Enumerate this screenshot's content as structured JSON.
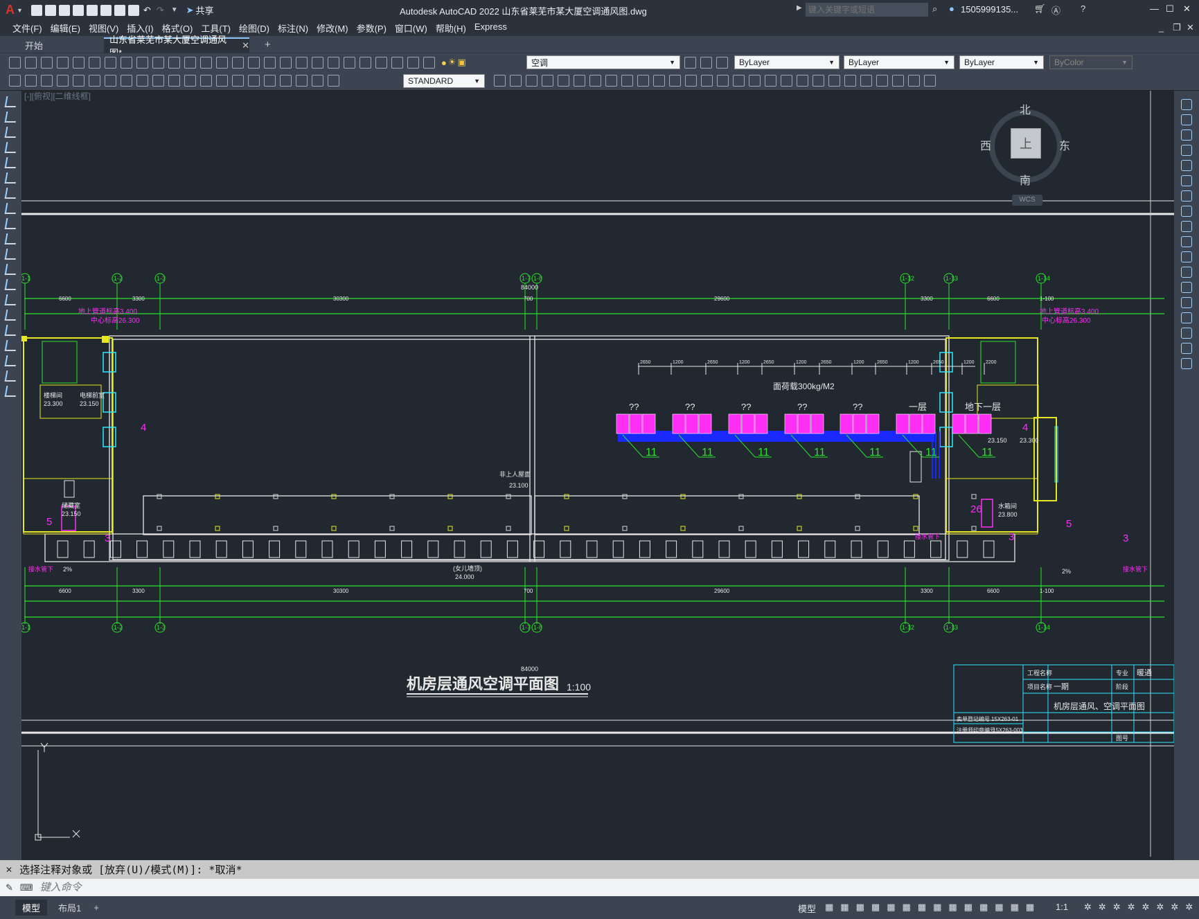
{
  "window": {
    "title": "Autodesk AutoCAD 2022    山东省莱芜市某大厦空调通风图.dwg",
    "share": "共享",
    "search_placeholder": "键入关键字或短语",
    "user": "1505999135...",
    "controls": {
      "min": "—",
      "max": "☐",
      "close": "✕"
    }
  },
  "menubar": {
    "items": [
      "文件(F)",
      "编辑(E)",
      "视图(V)",
      "插入(I)",
      "格式(O)",
      "工具(T)",
      "绘图(D)",
      "标注(N)",
      "修改(M)",
      "参数(P)",
      "窗口(W)",
      "帮助(H)",
      "Express"
    ]
  },
  "tabs": {
    "items": [
      {
        "label": "开始",
        "active": false
      },
      {
        "label": "山东省莱芜市某大厦空调通风图*",
        "active": true
      }
    ],
    "add": "+"
  },
  "toolbar1": {
    "layer": "空调",
    "color": "ByLayer",
    "linetype": "ByLayer",
    "lineweight": "ByLayer",
    "plotstyle": "ByColor"
  },
  "toolbar2": {
    "textstyle": "STANDARD"
  },
  "viewport": {
    "label": "[-][俯视][二维线框]",
    "viewcube": {
      "top": "上",
      "north": "北",
      "south": "南",
      "east": "东",
      "west": "西",
      "wcs": "WCS"
    }
  },
  "drawing": {
    "title": "机房层通风空调平面图",
    "scale": "1:100",
    "grid_top": [
      "1-1",
      "1-2",
      "1-3",
      "1-7",
      "1-8",
      "1-12",
      "1-13",
      "1-14"
    ],
    "grid_bottom": [
      "1-1",
      "1-2",
      "1-3",
      "1-7",
      "1-8",
      "1-12",
      "1-13",
      "1-14"
    ],
    "dims": [
      "6600",
      "3300",
      "30300",
      "700",
      "29600",
      "3300",
      "6600",
      "1-100"
    ],
    "total": "84000",
    "annot_left": [
      "地上管道标高3.400",
      "中心标高26.300"
    ],
    "annot_right": [
      "地上管道标高3.400",
      "中心标高26.300"
    ],
    "equip_labels": [
      "??",
      "??",
      "??",
      "??",
      "??",
      "一层",
      "地下一层"
    ],
    "equip_tags": [
      "11",
      "11",
      "11",
      "11",
      "11",
      "11",
      "11"
    ],
    "load_note": "面荷载300kg/M2",
    "small_dims": [
      "2650",
      "1200",
      "2650",
      "1200",
      "2650",
      "1200",
      "2650",
      "1200",
      "2650",
      "1200",
      "2650",
      "1200",
      "2200"
    ],
    "room_left_labels": [
      "楼梯间",
      "23.300",
      "电梯前室",
      "23.150",
      "储藏室",
      "23.150"
    ],
    "room_right_labels": [
      "23.150",
      "23.300",
      "水箱间",
      "23.800"
    ],
    "center_labels": [
      "非上人屋面",
      "23.100",
      "(女儿墙顶)",
      "24.000"
    ],
    "tags_magenta": [
      "4",
      "5",
      "3",
      "4",
      "5",
      "3",
      "26",
      "3"
    ],
    "pipe_notes": [
      "接水管下",
      "接水管下",
      "接水管下"
    ],
    "pct_notes": [
      "2%",
      "2%"
    ],
    "title_block": {
      "rows": [
        [
          "工程名称",
          "",
          "专业",
          "暖通"
        ],
        [
          "项目名称",
          "一期",
          "阶段",
          ""
        ],
        [
          "",
          "机房层通风、空调平面图",
          "",
          ""
        ],
        [
          "",
          "",
          "图号",
          ""
        ]
      ],
      "side": [
        "卖单登记编号",
        "15X263-01",
        "注册师印章编号",
        "15X263-003"
      ]
    }
  },
  "command": {
    "history": "选择注释对象或 [放弃(U)/模式(M)]: *取消*",
    "placeholder": "键入命令"
  },
  "layouts": {
    "items": [
      "模型",
      "布局1"
    ],
    "add": "+"
  },
  "status": {
    "model": "模型",
    "scale": "1:1"
  }
}
